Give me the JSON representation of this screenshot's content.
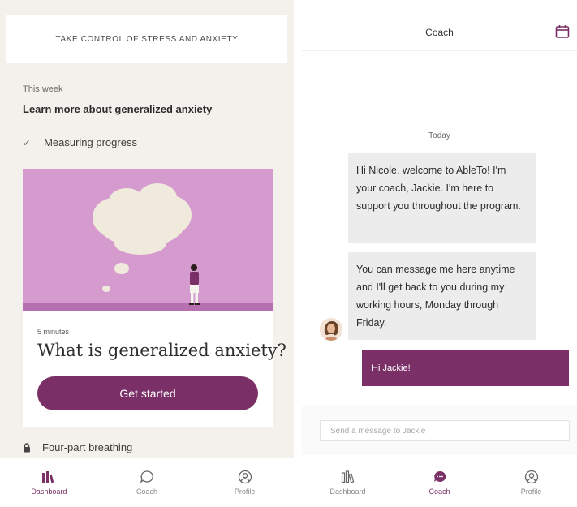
{
  "colors": {
    "brand": "#7a2f66",
    "illustration_bg": "#d59bcf",
    "cream": "#f4f1ec"
  },
  "left": {
    "header_title": "TAKE CONTROL OF STRESS AND ANXIETY",
    "week_label": "This week",
    "week_title": "Learn more about generalized anxiety",
    "completed_item": "Measuring progress",
    "card": {
      "meta": "5 minutes",
      "title": "What is generalized anxiety?",
      "cta": "Get started"
    },
    "locked_item": "Four-part breathing",
    "tabs": [
      {
        "label": "Dashboard",
        "icon": "dashboard-icon",
        "active": true
      },
      {
        "label": "Coach",
        "icon": "chat-bubble-icon",
        "active": false
      },
      {
        "label": "Profile",
        "icon": "profile-icon",
        "active": false
      }
    ]
  },
  "right": {
    "header_title": "Coach",
    "header_icon": "calendar-icon",
    "date_label": "Today",
    "messages": [
      {
        "from": "coach",
        "text": "Hi Nicole, welcome to AbleTo! I'm your coach, Jackie. I'm here to support you throughout the program."
      },
      {
        "from": "coach",
        "text": "You can message me here anytime and I'll get back to you during my working hours, Monday through Friday."
      },
      {
        "from": "user",
        "text": "Hi Jackie!"
      }
    ],
    "input_placeholder": "Send a message to Jackie",
    "tabs": [
      {
        "label": "Dashboard",
        "icon": "dashboard-icon",
        "active": false
      },
      {
        "label": "Coach",
        "icon": "chat-bubble-icon",
        "active": true
      },
      {
        "label": "Profile",
        "icon": "profile-icon",
        "active": false
      }
    ]
  }
}
